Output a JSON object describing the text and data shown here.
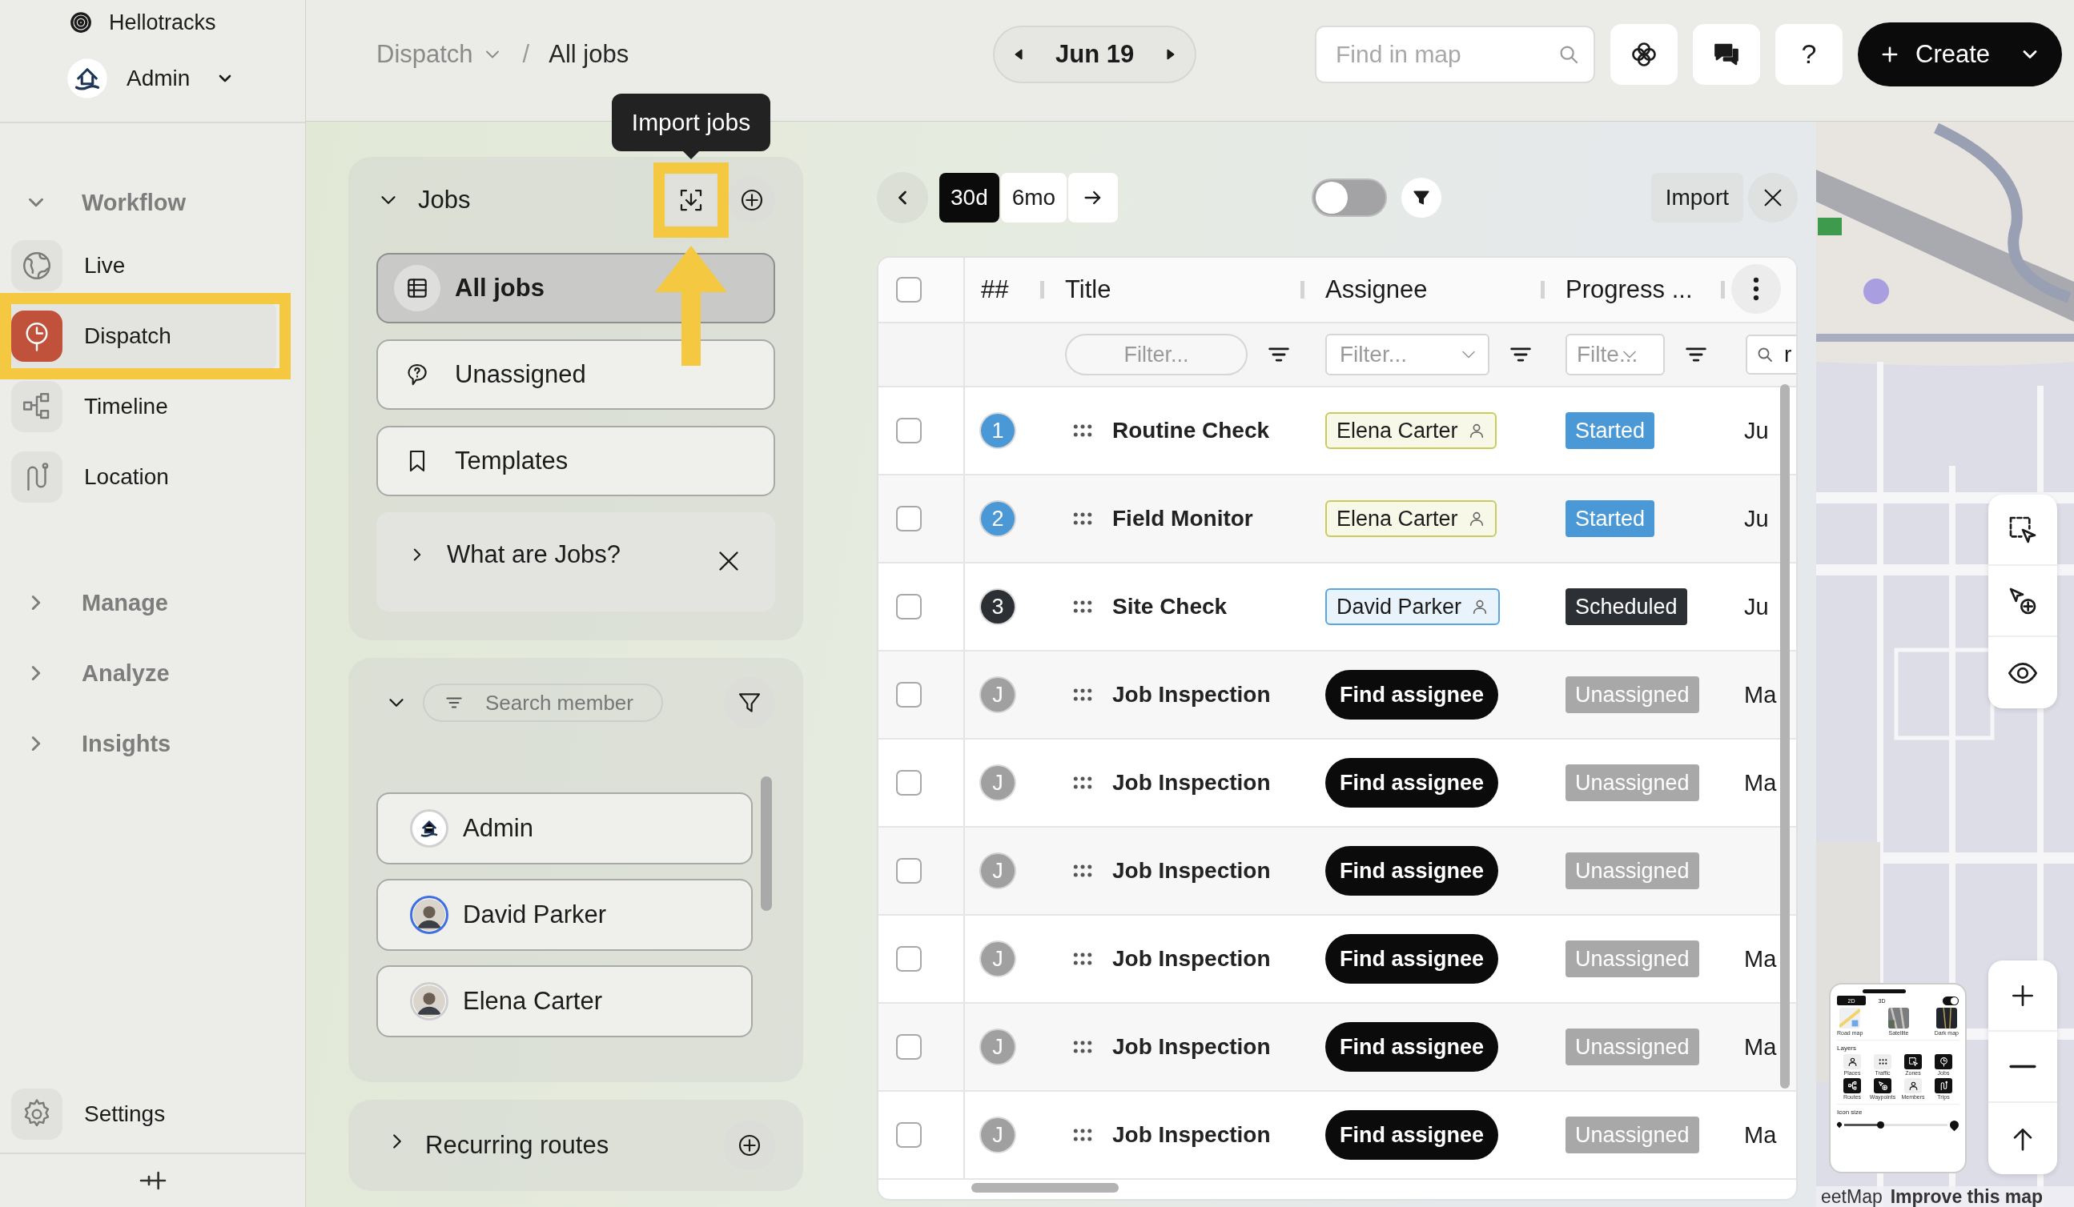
{
  "sidebar": {
    "brand": "Hellotracks",
    "account": "Admin",
    "sections": [
      {
        "label": "Workflow",
        "expanded": true,
        "items": [
          {
            "label": "Live",
            "selected": false,
            "highlighted": false
          },
          {
            "label": "Dispatch",
            "selected": true,
            "highlighted": true
          },
          {
            "label": "Timeline",
            "selected": false,
            "highlighted": false
          },
          {
            "label": "Location",
            "selected": false,
            "highlighted": false
          }
        ]
      },
      {
        "label": "Manage",
        "expanded": false
      },
      {
        "label": "Analyze",
        "expanded": false
      },
      {
        "label": "Insights",
        "expanded": false
      }
    ],
    "settings": "Settings"
  },
  "header": {
    "breadcrumb": {
      "parent": "Dispatch",
      "separator": "/",
      "current": "All jobs"
    },
    "date": "Jun 19",
    "search": {
      "placeholder": "Find in map"
    },
    "help": "?",
    "create": "Create"
  },
  "jobs_panel": {
    "title": "Jobs",
    "expanded": true,
    "import_button": {
      "tooltip": "Import jobs",
      "highlighted": true
    },
    "views": [
      {
        "label": "All jobs",
        "selected": true
      },
      {
        "label": "Unassigned",
        "selected": false
      },
      {
        "label": "Templates",
        "selected": false
      }
    ],
    "hint": "What are Jobs?"
  },
  "members_panel": {
    "expanded": true,
    "search": {
      "placeholder": "Search member"
    },
    "members": [
      {
        "name": "Admin",
        "color": "#d0d0d0"
      },
      {
        "name": "David Parker",
        "color": "#3f6fe0"
      },
      {
        "name": "Elena Carter",
        "color": "#cfcfcf"
      }
    ]
  },
  "routes_panel": {
    "title": "Recurring routes",
    "expanded": false
  },
  "toolbar": {
    "ranges": [
      {
        "label": "30d",
        "selected": true
      },
      {
        "label": "6mo",
        "selected": false
      }
    ],
    "toggle": {
      "on": false
    },
    "import": "Import"
  },
  "table": {
    "select_all": {
      "checked": false
    },
    "columns": [
      "##",
      "Title",
      "Assignee",
      "Progress ..."
    ],
    "filters": [
      {
        "kind": "pill",
        "placeholder": "Filter..."
      },
      {
        "kind": "dropdown",
        "placeholder": "Filter..."
      },
      {
        "kind": "dropdown",
        "placeholder": "Filte..."
      },
      {
        "kind": "search",
        "value": "r"
      }
    ],
    "rows": [
      {
        "checked": false,
        "badge": {
          "label": "1",
          "color": "#4a98d6"
        },
        "title": "Routine Check",
        "assignee": {
          "kind": "member",
          "name": "Elena Carter",
          "color": "#c9cc5c"
        },
        "status": {
          "label": "Started",
          "color": "#4a98d6"
        },
        "column_5": "Ju"
      },
      {
        "checked": false,
        "badge": {
          "label": "2",
          "color": "#4a98d6"
        },
        "title": "Field Monitor",
        "assignee": {
          "kind": "member",
          "name": "Elena Carter",
          "color": "#c9cc5c"
        },
        "status": {
          "label": "Started",
          "color": "#4a98d6"
        },
        "column_5": "Ju"
      },
      {
        "checked": false,
        "badge": {
          "label": "3",
          "color": "#2c3034"
        },
        "title": "Site Check",
        "assignee": {
          "kind": "member",
          "name": "David Parker",
          "color": "#5aa6e0"
        },
        "status": {
          "label": "Scheduled",
          "color": "#2c3034"
        },
        "column_5": "Ju"
      },
      {
        "checked": false,
        "badge": {
          "label": "J",
          "color": "#a0a0a0"
        },
        "title": "Job Inspection",
        "assignee": {
          "kind": "button",
          "label": "Find assignee"
        },
        "status": {
          "label": "Unassigned",
          "color": "#a8a8a8"
        },
        "column_5": "Ma"
      },
      {
        "checked": false,
        "badge": {
          "label": "J",
          "color": "#a0a0a0"
        },
        "title": "Job Inspection",
        "assignee": {
          "kind": "button",
          "label": "Find assignee"
        },
        "status": {
          "label": "Unassigned",
          "color": "#a8a8a8"
        },
        "column_5": "Ma"
      },
      {
        "checked": false,
        "badge": {
          "label": "J",
          "color": "#a0a0a0"
        },
        "title": "Job Inspection",
        "assignee": {
          "kind": "button",
          "label": "Find assignee"
        },
        "status": {
          "label": "Unassigned",
          "color": "#a8a8a8"
        }
      },
      {
        "checked": false,
        "badge": {
          "label": "J",
          "color": "#a0a0a0"
        },
        "title": "Job Inspection",
        "assignee": {
          "kind": "button",
          "label": "Find assignee"
        },
        "status": {
          "label": "Unassigned",
          "color": "#a8a8a8"
        },
        "column_5": "Ma"
      },
      {
        "checked": false,
        "badge": {
          "label": "J",
          "color": "#a0a0a0"
        },
        "title": "Job Inspection",
        "assignee": {
          "kind": "button",
          "label": "Find assignee"
        },
        "status": {
          "label": "Unassigned",
          "color": "#a8a8a8"
        },
        "column_5": "Ma"
      },
      {
        "checked": false,
        "badge": {
          "label": "J",
          "color": "#a0a0a0"
        },
        "title": "Job Inspection",
        "assignee": {
          "kind": "button",
          "label": "Find assignee"
        },
        "status": {
          "label": "Unassigned",
          "color": "#a8a8a8"
        },
        "column_5": "Ma"
      }
    ]
  },
  "map": {
    "kind": "picture",
    "attribution": {
      "source": "eetMap",
      "link": "Improve this map"
    },
    "layers_card": {
      "modes": [
        {
          "label": "2D",
          "selected": true
        },
        {
          "label": "3D",
          "selected": false
        }
      ],
      "toggle": {
        "on": true
      },
      "styles": [
        {
          "label": "Road map",
          "kind": "road"
        },
        {
          "label": "Satellite",
          "kind": "satellite"
        },
        {
          "label": "Dark map",
          "kind": "dark"
        }
      ],
      "layers_title": "Layers",
      "layers": [
        {
          "label": "Places",
          "on": false
        },
        {
          "label": "Traffic",
          "on": false
        },
        {
          "label": "Zones",
          "on": true
        },
        {
          "label": "Jobs",
          "on": true
        },
        {
          "label": "Routes",
          "on": true
        },
        {
          "label": "Waypoints",
          "on": true
        },
        {
          "label": "Members",
          "on": false
        },
        {
          "label": "Trips",
          "on": true
        }
      ],
      "icon_size": {
        "label": "Icon size",
        "level": 0.35
      }
    }
  }
}
